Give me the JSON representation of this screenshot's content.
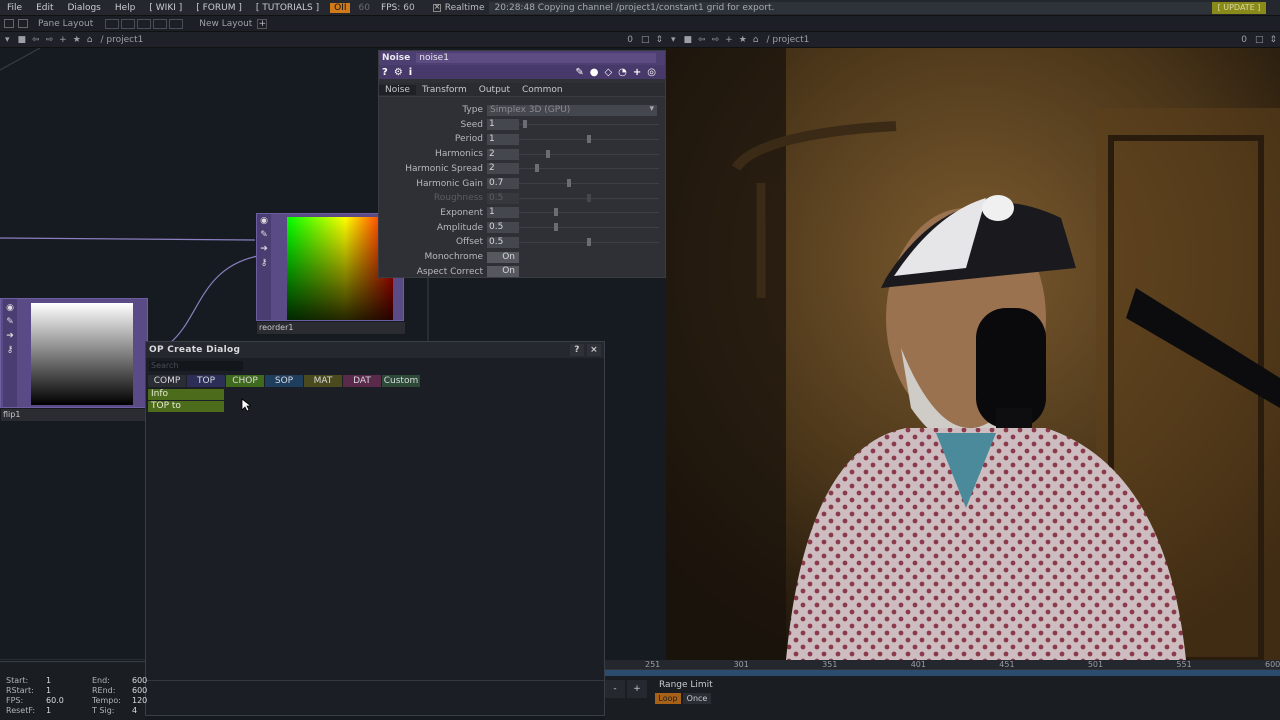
{
  "menubar": {
    "items": [
      "File",
      "Edit",
      "Dialogs",
      "Help",
      "[ WIKI ]",
      "[ FORUM ]",
      "[ TUTORIALS ]"
    ],
    "oi": "OII",
    "fps_cap": "60",
    "fps_label": "FPS:",
    "fps_value": "60",
    "realtime": "Realtime",
    "status": "20:28:48 Copying channel /project1/constant1 grid for export.",
    "update": "[ UPDATE ]"
  },
  "panebar": {
    "pane_layout": "Pane Layout",
    "new_layout": "New Layout",
    "plus": "+"
  },
  "path_left": "/ project1",
  "path_right": "/ project1",
  "path_counter_left": "0",
  "path_counter_right": "0",
  "param": {
    "op_type": "Noise",
    "op_name": "noise1",
    "tabs": [
      "Noise",
      "Transform",
      "Output",
      "Common"
    ],
    "rows": [
      {
        "label": "Type",
        "dropdown": "Simplex 3D (GPU)"
      },
      {
        "label": "Seed",
        "value": "1",
        "knob": 0.03
      },
      {
        "label": "Period",
        "value": "1",
        "knob": 0.5
      },
      {
        "label": "Harmonics",
        "value": "2",
        "knob": 0.2
      },
      {
        "label": "Harmonic Spread",
        "value": "2",
        "knob": 0.12
      },
      {
        "label": "Harmonic Gain",
        "value": "0.7",
        "knob": 0.35
      },
      {
        "label": "Roughness",
        "value": "0.5",
        "knob": 0.5,
        "dim": true
      },
      {
        "label": "Exponent",
        "value": "1",
        "knob": 0.26
      },
      {
        "label": "Amplitude",
        "value": "0.5",
        "knob": 0.26
      },
      {
        "label": "Offset",
        "value": "0.5",
        "knob": 0.5
      },
      {
        "label": "Monochrome",
        "toggle": "On"
      },
      {
        "label": "Aspect Correct",
        "toggle": "On"
      }
    ]
  },
  "nodes": {
    "reorder": "reorder1",
    "flip": "flip1"
  },
  "opcreate": {
    "title": "OP Create Dialog",
    "help": "?",
    "close": "×",
    "search_placeholder": "Search",
    "families": [
      {
        "label": "COMP",
        "color": "#2a2d33"
      },
      {
        "label": "TOP",
        "color": "#2c2e58"
      },
      {
        "label": "CHOP",
        "color": "#3f6a1e"
      },
      {
        "label": "SOP",
        "color": "#1f3e5e"
      },
      {
        "label": "MAT",
        "color": "#4a4a1e"
      },
      {
        "label": "DAT",
        "color": "#5a2a4a"
      },
      {
        "label": "Custom",
        "color": "#2d4a38"
      }
    ],
    "list": [
      "Info",
      "TOP to"
    ]
  },
  "timeline": {
    "ticks": [
      "251",
      "301",
      "351",
      "401",
      "451",
      "501",
      "551",
      "600"
    ],
    "range_limit": "Range Limit",
    "loop": "Loop",
    "once": "Once",
    "minus": "-",
    "plus": "+"
  },
  "stats": {
    "start_label": "Start:",
    "start": "1",
    "rstart_label": "RStart:",
    "rstart": "1",
    "fps_label": "FPS:",
    "fps": "60.0",
    "reset_label": "ResetF:",
    "reset": "1",
    "end_label": "End:",
    "end": "600",
    "rend_label": "REnd:",
    "rend": "600",
    "tempo_label": "Tempo:",
    "tempo": "120",
    "tsig_label": "T Sig:",
    "tsig": "4"
  }
}
